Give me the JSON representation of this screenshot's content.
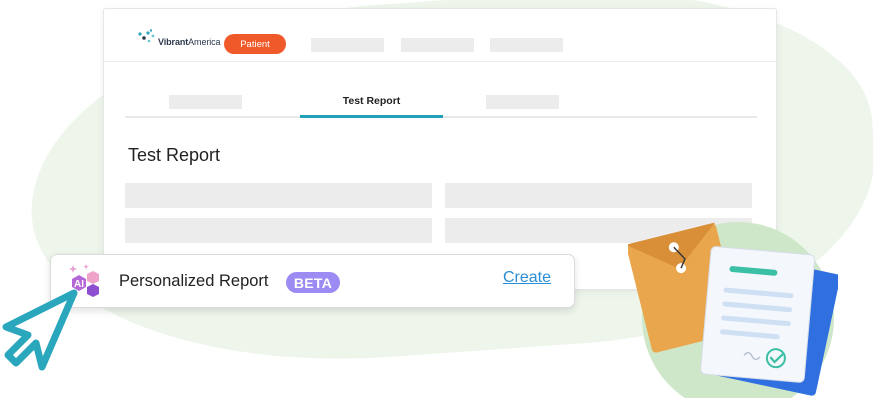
{
  "header": {
    "logo_bold": "Vibrant",
    "logo_rest": "America",
    "role_button": "Patient"
  },
  "tabs": {
    "active_label": "Test Report"
  },
  "main": {
    "title": "Test Report"
  },
  "report_card": {
    "label": "Personalized Report",
    "badge": "BETA",
    "icon_text": "AI",
    "action_link": "Create"
  },
  "colors": {
    "accent_orange": "#f05a2a",
    "tab_underline": "#1fa1b6",
    "beta_purple": "#9b8bf2",
    "link_blue": "#2a8fd6",
    "cursor_teal": "#2aa7bd"
  },
  "icons": [
    "vibrant-america-logo",
    "ai-sparkle-icon",
    "pointer-cursor-icon",
    "documents-illustration"
  ]
}
